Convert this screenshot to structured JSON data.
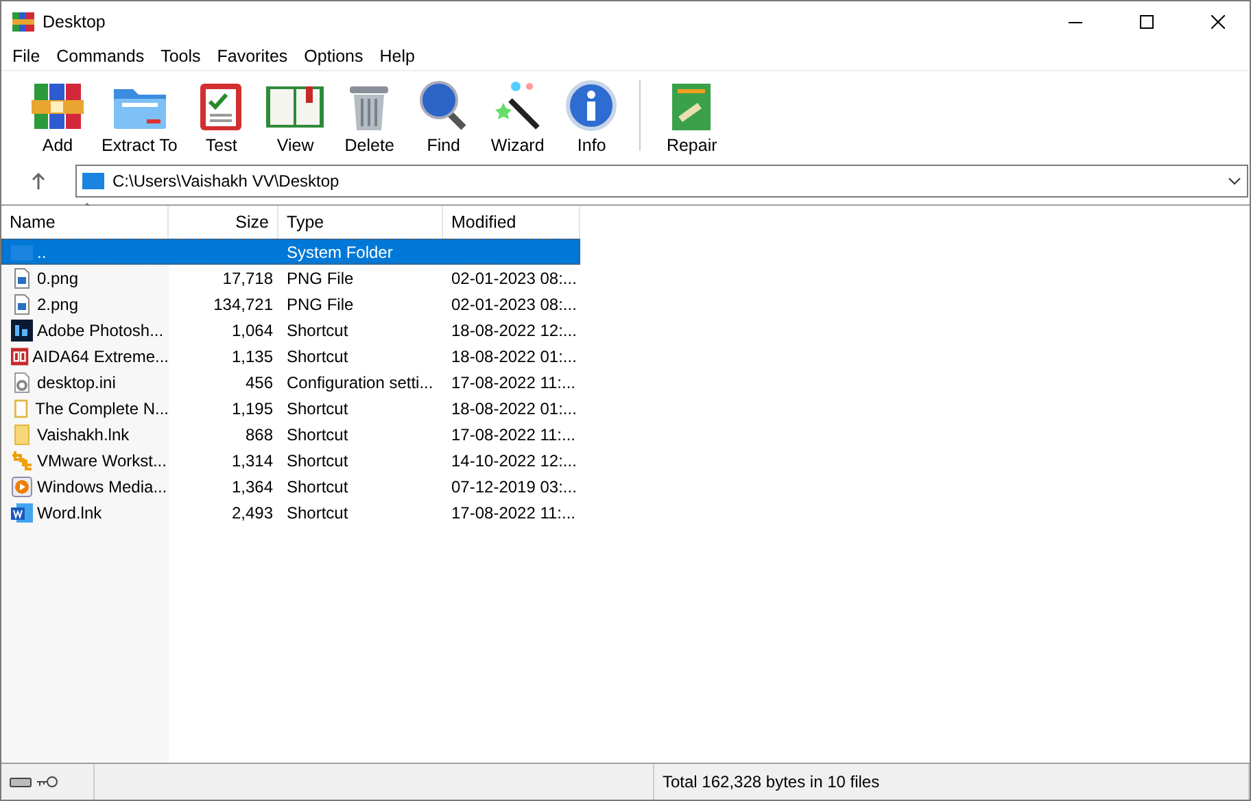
{
  "window": {
    "title": "Desktop"
  },
  "menu": [
    "File",
    "Commands",
    "Tools",
    "Favorites",
    "Options",
    "Help"
  ],
  "toolbar": [
    {
      "label": "Add",
      "kind": "archive"
    },
    {
      "label": "Extract To",
      "kind": "folder"
    },
    {
      "label": "Test",
      "kind": "clipboard"
    },
    {
      "label": "View",
      "kind": "book"
    },
    {
      "label": "Delete",
      "kind": "trash"
    },
    {
      "label": "Find",
      "kind": "magnifier"
    },
    {
      "label": "Wizard",
      "kind": "wand"
    },
    {
      "label": "Info",
      "kind": "info"
    },
    {
      "label": "Repair",
      "kind": "repair"
    }
  ],
  "address": {
    "path": "C:\\Users\\Vaishakh VV\\Desktop"
  },
  "table": {
    "columns": [
      "Name",
      "Size",
      "Type",
      "Modified"
    ],
    "rows": [
      {
        "name": "..",
        "size": "",
        "type": "System Folder",
        "modified": "",
        "kind": "desktop",
        "selected": true
      },
      {
        "name": "0.png",
        "size": "17,718",
        "type": "PNG File",
        "modified": "02-01-2023 08:...",
        "kind": "image",
        "selected": false
      },
      {
        "name": "2.png",
        "size": "134,721",
        "type": "PNG File",
        "modified": "02-01-2023 08:...",
        "kind": "image",
        "selected": false
      },
      {
        "name": "Adobe Photosh...",
        "size": "1,064",
        "type": "Shortcut",
        "modified": "18-08-2022 12:...",
        "kind": "ps",
        "selected": false
      },
      {
        "name": "AIDA64 Extreme...",
        "size": "1,135",
        "type": "Shortcut",
        "modified": "18-08-2022 01:...",
        "kind": "aida",
        "selected": false
      },
      {
        "name": "desktop.ini",
        "size": "456",
        "type": "Configuration setti...",
        "modified": "17-08-2022 11:...",
        "kind": "ini",
        "selected": false
      },
      {
        "name": "The Complete N...",
        "size": "1,195",
        "type": "Shortcut",
        "modified": "18-08-2022 01:...",
        "kind": "blank",
        "selected": false
      },
      {
        "name": "Vaishakh.lnk",
        "size": "868",
        "type": "Shortcut",
        "modified": "17-08-2022 11:...",
        "kind": "folder",
        "selected": false
      },
      {
        "name": "VMware Workst...",
        "size": "1,314",
        "type": "Shortcut",
        "modified": "14-10-2022 12:...",
        "kind": "vmware",
        "selected": false
      },
      {
        "name": "Windows Media...",
        "size": "1,364",
        "type": "Shortcut",
        "modified": "07-12-2019 03:...",
        "kind": "media",
        "selected": false
      },
      {
        "name": "Word.lnk",
        "size": "2,493",
        "type": "Shortcut",
        "modified": "17-08-2022 11:...",
        "kind": "word",
        "selected": false
      }
    ]
  },
  "status_bar": {
    "text": "Total 162,328 bytes in 10 files"
  }
}
